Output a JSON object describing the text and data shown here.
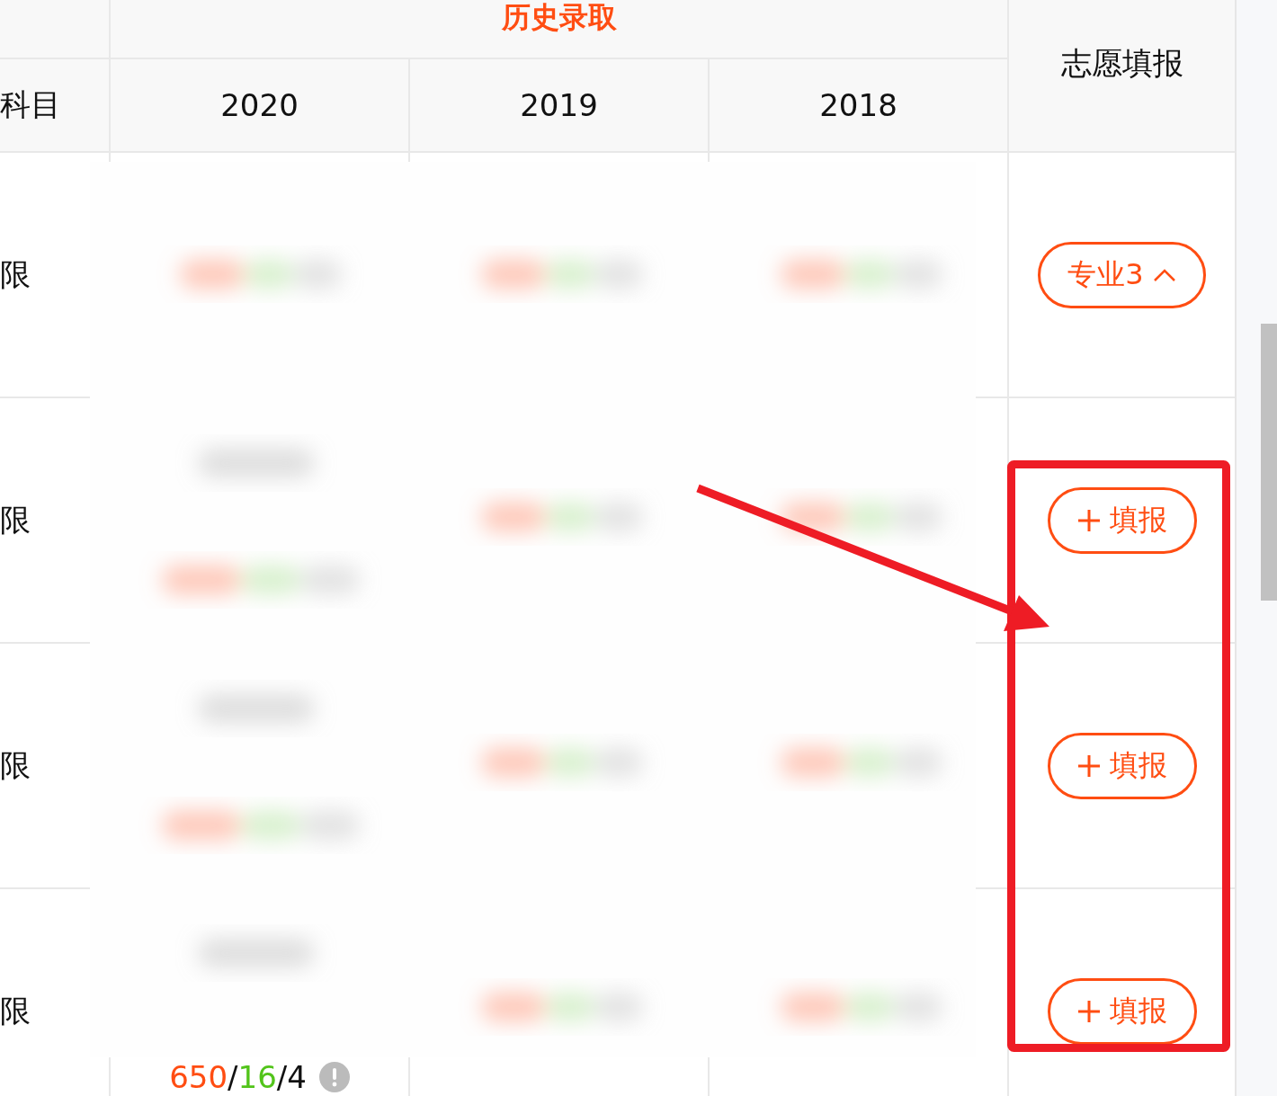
{
  "table": {
    "header": {
      "group_title": "历史录取",
      "column_0": "科目",
      "years": [
        "2020",
        "2019",
        "2018"
      ],
      "action_title": "志愿填报"
    },
    "rows": [
      {
        "column_0": "限",
        "action": {
          "kind": "expand",
          "label": "专业3",
          "expanded": true
        }
      },
      {
        "column_0": "限",
        "action": {
          "kind": "add",
          "label": "填报"
        }
      },
      {
        "column_0": "限",
        "action": {
          "kind": "add",
          "label": "填报"
        }
      },
      {
        "column_0": "限",
        "action": {
          "kind": "add",
          "label": "填报"
        },
        "stat": [
          {
            "text": "650",
            "kind": "score"
          },
          {
            "text": "/",
            "kind": "plain"
          },
          {
            "text": "16",
            "kind": "rank"
          },
          {
            "text": "/",
            "kind": "plain"
          },
          {
            "text": "4",
            "kind": "plain"
          }
        ]
      }
    ]
  }
}
